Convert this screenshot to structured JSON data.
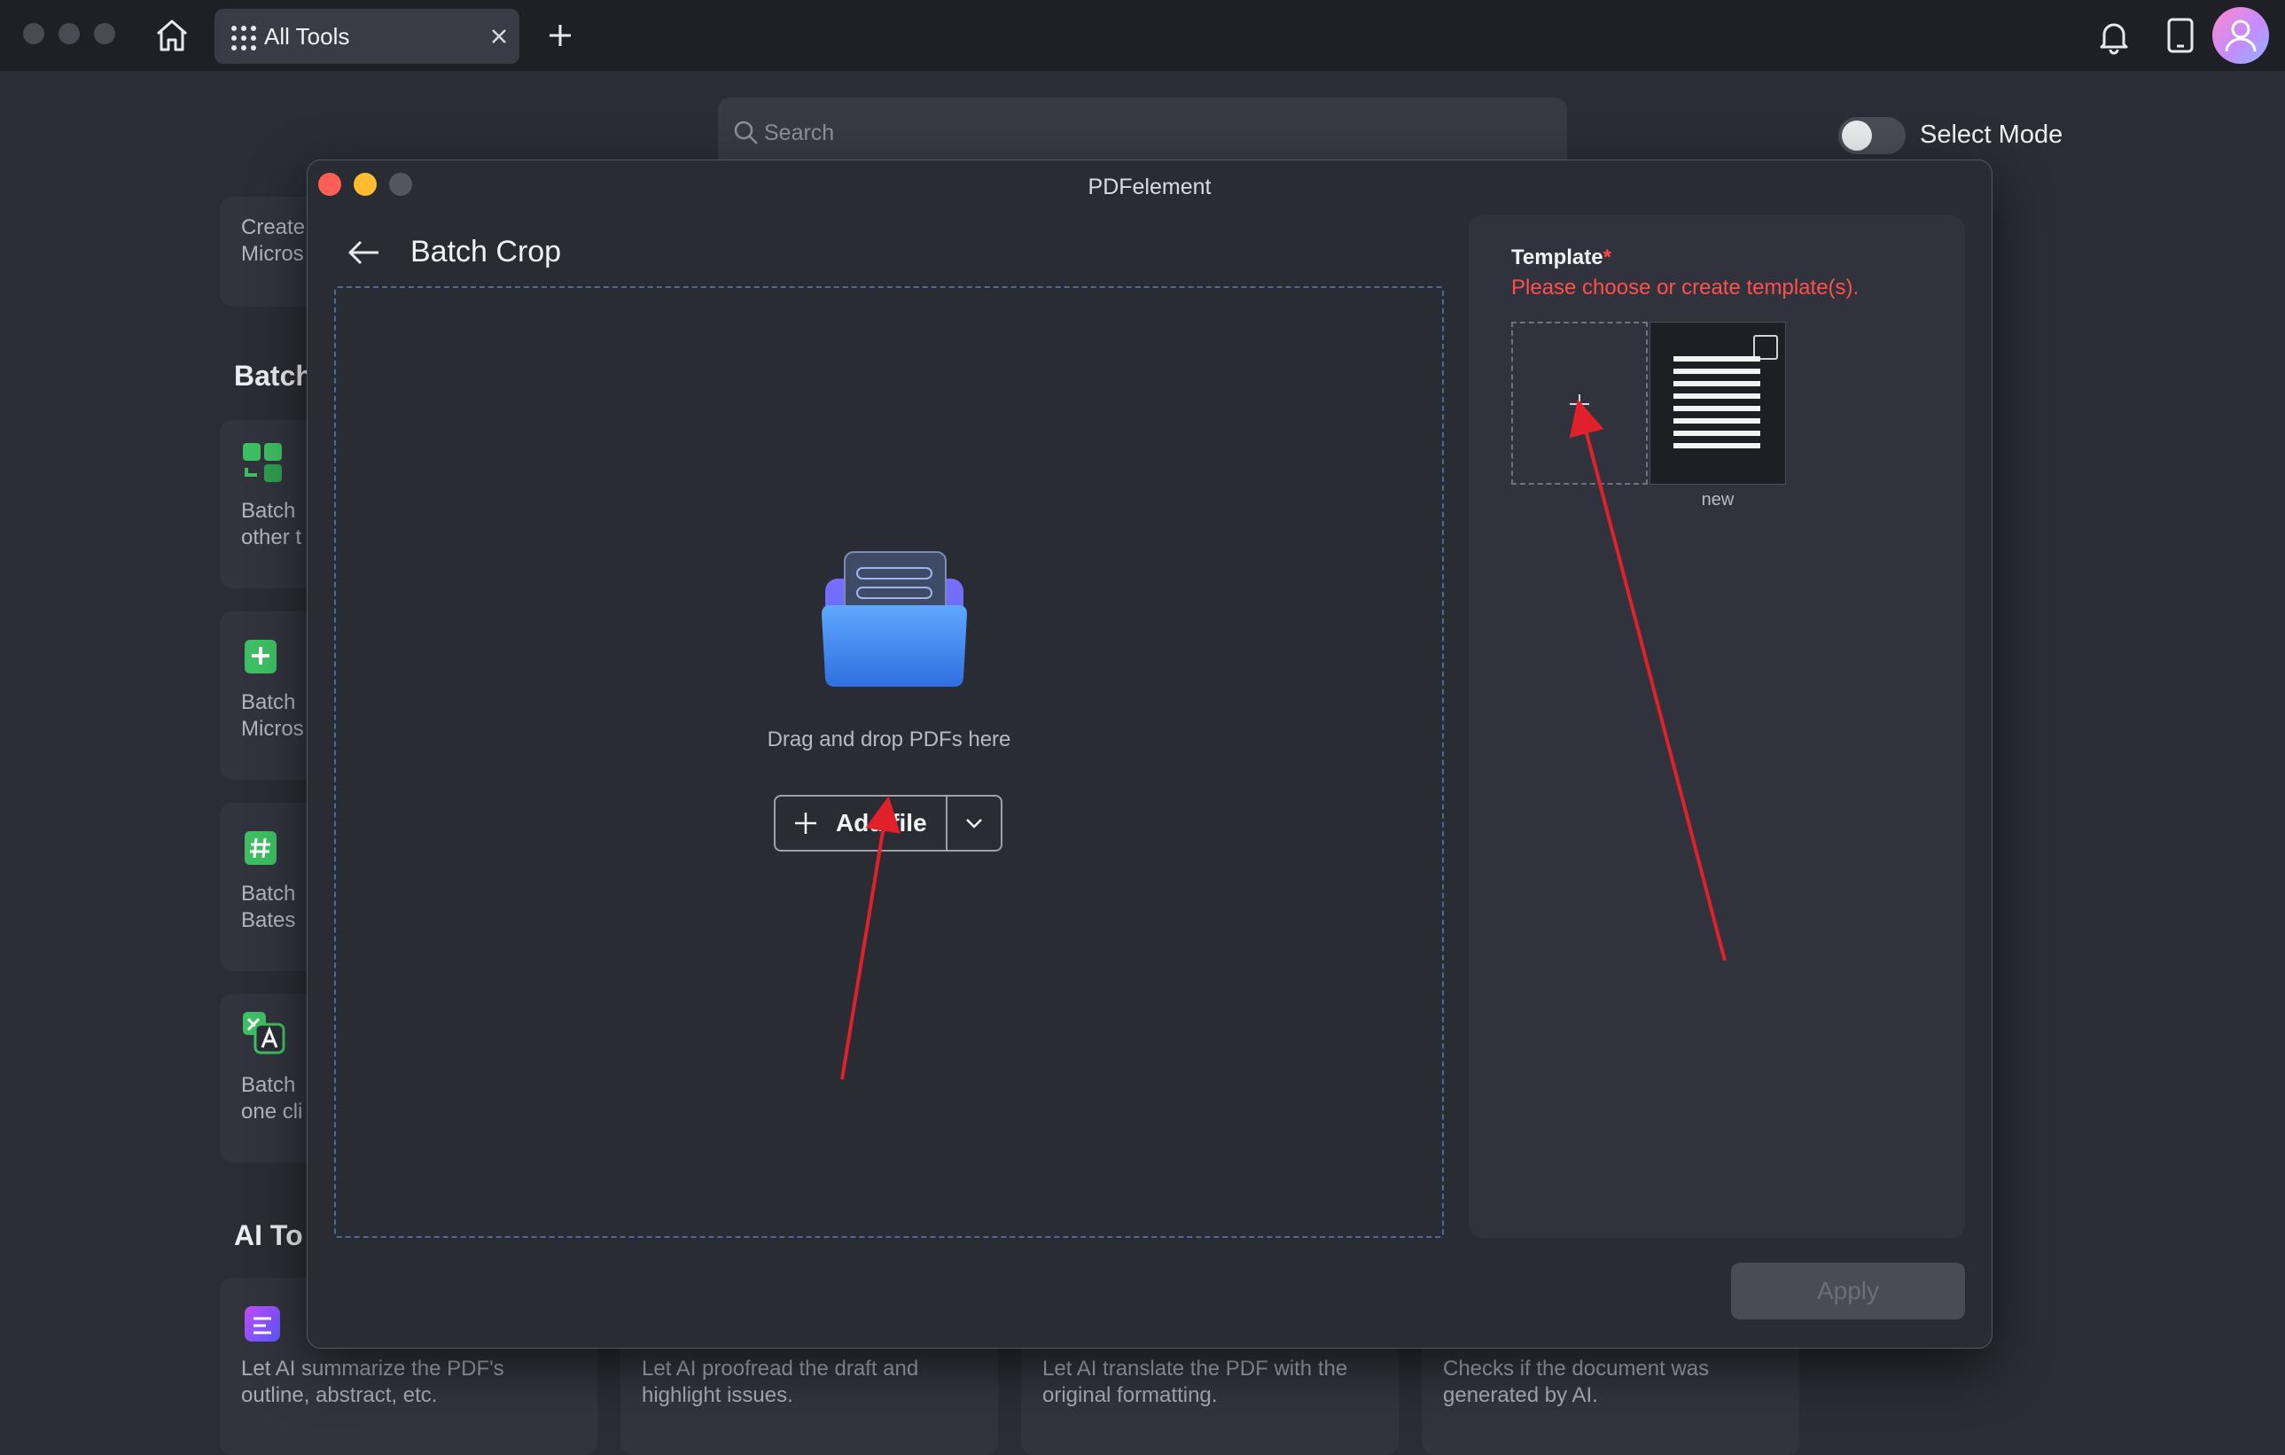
{
  "app": {
    "tab_label": "All Tools",
    "search_placeholder": "Search",
    "select_mode_label": "Select Mode",
    "icons": [
      "home-icon",
      "apps-grid-icon",
      "close-icon",
      "plus-icon",
      "bell-icon",
      "tablet-icon",
      "avatar"
    ],
    "background": {
      "card_top_text": [
        "Create",
        "Micros"
      ],
      "section_batch": "Batch",
      "batch_cards": [
        {
          "line1": "Batch",
          "line2": "other t",
          "icon_color": "#3fbf63"
        },
        {
          "line1": "Batch",
          "line2": "Micros",
          "icon_color": "#3fbf63"
        },
        {
          "line1": "Batch",
          "line2": "Bates",
          "icon_color": "#3fbf63"
        },
        {
          "line1": "Batch",
          "line2": "one cli",
          "icon_color": "#3fbf63"
        }
      ],
      "section_ai": "AI To",
      "ai_cards": [
        {
          "line1": "Let AI summarize the PDF's",
          "line2": "outline, abstract, etc."
        },
        {
          "line1": "Let AI proofread the draft and",
          "line2": "highlight issues."
        },
        {
          "line1": "Let AI translate the PDF with the",
          "line2": "original formatting."
        },
        {
          "line1": "Checks if the document was",
          "line2": "generated by AI."
        }
      ]
    }
  },
  "dialog": {
    "window_title": "PDFelement",
    "title": "Batch Crop",
    "drop_text": "Drag and drop PDFs here",
    "add_file_label": "Add file",
    "template": {
      "label": "Template",
      "required_mark": "*",
      "hint": "Please choose or create template(s).",
      "items": [
        {
          "name": "new"
        }
      ]
    },
    "apply_label": "Apply"
  },
  "colors": {
    "accent_error": "#ff4f4f",
    "annotation_arrow": "#e0202a",
    "traffic_red": "#ff5f57",
    "traffic_yellow": "#febc2e"
  }
}
